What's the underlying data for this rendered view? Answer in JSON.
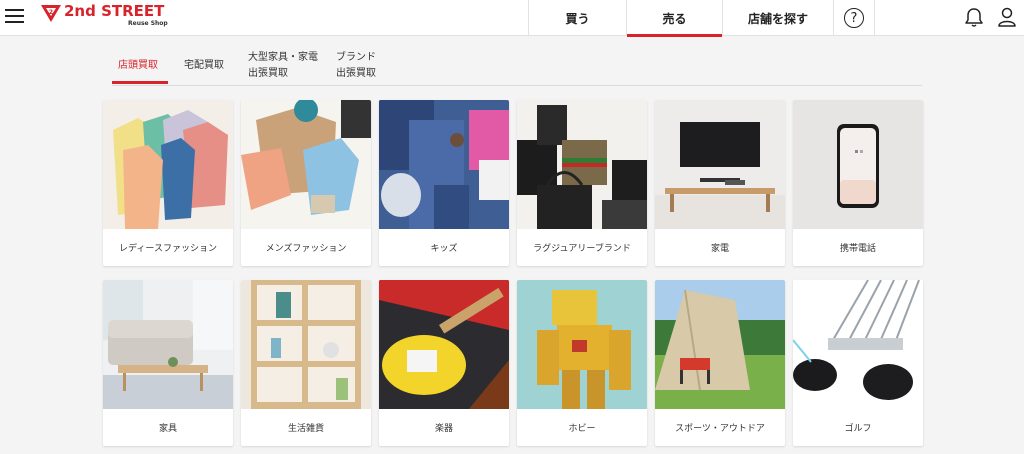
{
  "header": {
    "logo_text": "2nd STREET",
    "logo_sub": "Reuse Shop",
    "nav": {
      "buy": "買う",
      "sell": "売る",
      "store": "店舗を探す",
      "help": "?"
    }
  },
  "subtabs": {
    "store": "店頭買取",
    "delivery": "宅配買取",
    "large_line1": "大型家具・家電",
    "large_line2": "出張買取",
    "brand_line1": "ブランド",
    "brand_line2": "出張買取"
  },
  "categories": [
    {
      "label": "レディースファッション"
    },
    {
      "label": "メンズファッション"
    },
    {
      "label": "キッズ"
    },
    {
      "label": "ラグジュアリーブランド"
    },
    {
      "label": "家電"
    },
    {
      "label": "携帯電話"
    },
    {
      "label": "家具"
    },
    {
      "label": "生活雑貨"
    },
    {
      "label": "楽器"
    },
    {
      "label": "ホビー"
    },
    {
      "label": "スポーツ・アウトドア"
    },
    {
      "label": "ゴルフ"
    }
  ],
  "colors": {
    "brand_red": "#d8232a",
    "background": "#f4f4f4"
  },
  "icons": [
    "menu-icon",
    "logo-emblem-icon",
    "help-icon",
    "bell-icon",
    "user-icon"
  ]
}
